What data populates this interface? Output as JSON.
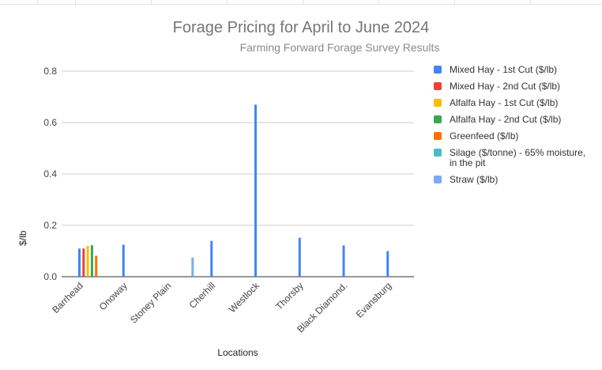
{
  "chart_data": {
    "type": "bar",
    "title": "Forage Pricing for April to June 2024",
    "subtitle": "Farming Forward Forage Survey Results",
    "xlabel": "Locations",
    "ylabel": "$/lb",
    "ylim": [
      0,
      0.8
    ],
    "yticks": [
      "0.0",
      "0.2",
      "0.4",
      "0.6",
      "0.8"
    ],
    "grid": true,
    "legend_position": "right",
    "categories": [
      "Barrhead",
      "Onoway",
      "Stoney Plain",
      "Cherhill",
      "Westlock",
      "Thorsby",
      "Black Diamond.",
      "Evansburg"
    ],
    "series": [
      {
        "name": "Mixed Hay - 1st Cut ($/lb)",
        "color": "#4285f4",
        "values": [
          0.11,
          0.125,
          null,
          0.14,
          0.67,
          0.152,
          0.122,
          0.1
        ]
      },
      {
        "name": "Mixed Hay - 2nd Cut ($/lb)",
        "color": "#ea4335",
        "values": [
          0.11,
          null,
          null,
          null,
          null,
          null,
          null,
          null
        ]
      },
      {
        "name": "Alfalfa Hay - 1st Cut ($/lb)",
        "color": "#fbbc04",
        "values": [
          0.12,
          null,
          null,
          null,
          null,
          null,
          null,
          null
        ]
      },
      {
        "name": "Alfalfa Hay - 2nd Cut ($/lb)",
        "color": "#34a853",
        "values": [
          0.123,
          null,
          null,
          null,
          null,
          null,
          null,
          null
        ]
      },
      {
        "name": "Greenfeed ($/lb)",
        "color": "#ff6d01",
        "values": [
          0.082,
          null,
          null,
          null,
          null,
          null,
          null,
          null
        ]
      },
      {
        "name": "Silage ($/tonne) - 65% moisture, in the pit",
        "color": "#46bdc6",
        "values": [
          null,
          null,
          null,
          null,
          null,
          null,
          null,
          null
        ]
      },
      {
        "name": "Straw ($/lb)",
        "color": "#7baaf7",
        "values": [
          null,
          null,
          0.075,
          null,
          null,
          null,
          null,
          null
        ]
      }
    ]
  }
}
